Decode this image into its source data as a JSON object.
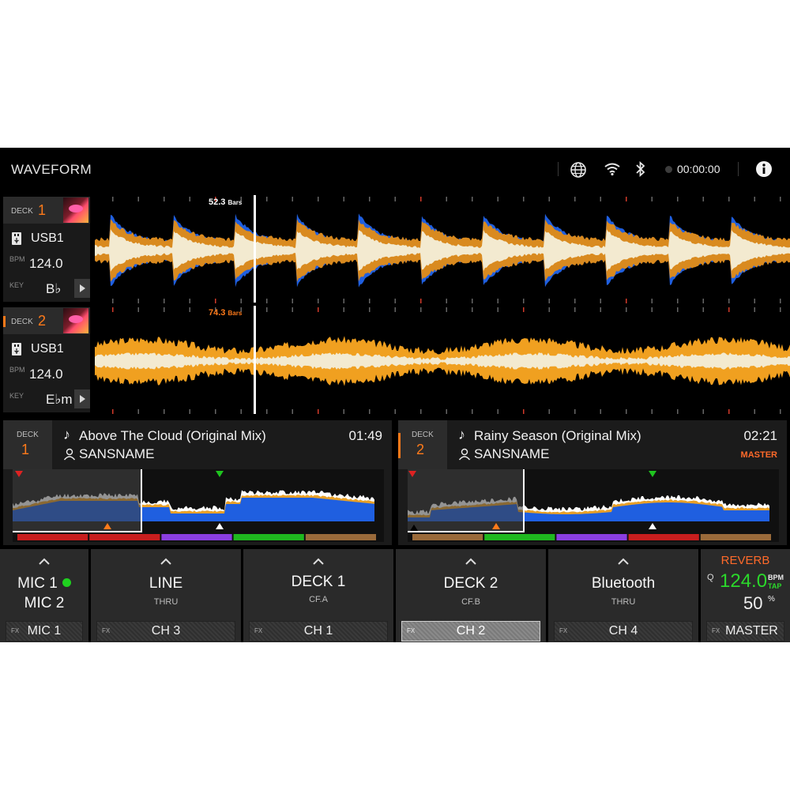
{
  "header": {
    "title": "WAVEFORM",
    "timer": "00:00:00",
    "icons": [
      "globe-icon",
      "wifi-icon",
      "bluetooth-icon",
      "record-indicator",
      "info-icon"
    ]
  },
  "decks": [
    {
      "label": "DECK",
      "number": "1",
      "source": "USB1",
      "bpm_label": "BPM",
      "bpm": "124.0",
      "key_label": "KEY",
      "key": "B♭",
      "bars": "52.3",
      "bars_unit": "Bars",
      "bars_color": "#ffffff"
    },
    {
      "label": "DECK",
      "number": "2",
      "source": "USB1",
      "bpm_label": "BPM",
      "bpm": "124.0",
      "key_label": "KEY",
      "key": "E♭m",
      "bars": "74.3",
      "bars_unit": "Bars",
      "bars_color": "#ff7a1a"
    }
  ],
  "tracks": [
    {
      "deck_label": "DECK",
      "deck_number": "1",
      "title": "Above The Cloud (Original Mix)",
      "artist": "SANSNAME",
      "time": "01:49",
      "master": ""
    },
    {
      "deck_label": "DECK",
      "deck_number": "2",
      "title": "Rainy Season (Original Mix)",
      "artist": "SANSNAME",
      "time": "02:21",
      "master": "MASTER"
    }
  ],
  "mixer": {
    "channels": [
      {
        "name": "MIC 1",
        "name2": "MIC 2",
        "sub": "",
        "fx_label": "FX",
        "fx_name": "MIC 1",
        "selected": false
      },
      {
        "name": "LINE",
        "sub": "THRU",
        "fx_label": "FX",
        "fx_name": "CH 3",
        "selected": false
      },
      {
        "name": "DECK 1",
        "sub": "CF.A",
        "fx_label": "FX",
        "fx_name": "CH 1",
        "selected": false
      },
      {
        "name": "DECK 2",
        "sub": "CF.B",
        "fx_label": "FX",
        "fx_name": "CH 2",
        "selected": true
      },
      {
        "name": "Bluetooth",
        "sub": "THRU",
        "fx_label": "FX",
        "fx_name": "CH 4",
        "selected": false
      }
    ],
    "fx": {
      "name": "REVERB",
      "q_label": "Q",
      "bpm": "124.0",
      "bpm_label": "BPM",
      "tap_label": "TAP",
      "level": "50",
      "level_unit": "%",
      "fx_label": "FX",
      "target": "MASTER"
    }
  },
  "colors": {
    "accent": "#ff7a1a",
    "wave_blue": "#1f5fe0",
    "wave_orange": "#f0a020",
    "wave_cream": "#f3ead0",
    "fx_green": "#2bd82b",
    "mic_active": "#1fd11f"
  }
}
